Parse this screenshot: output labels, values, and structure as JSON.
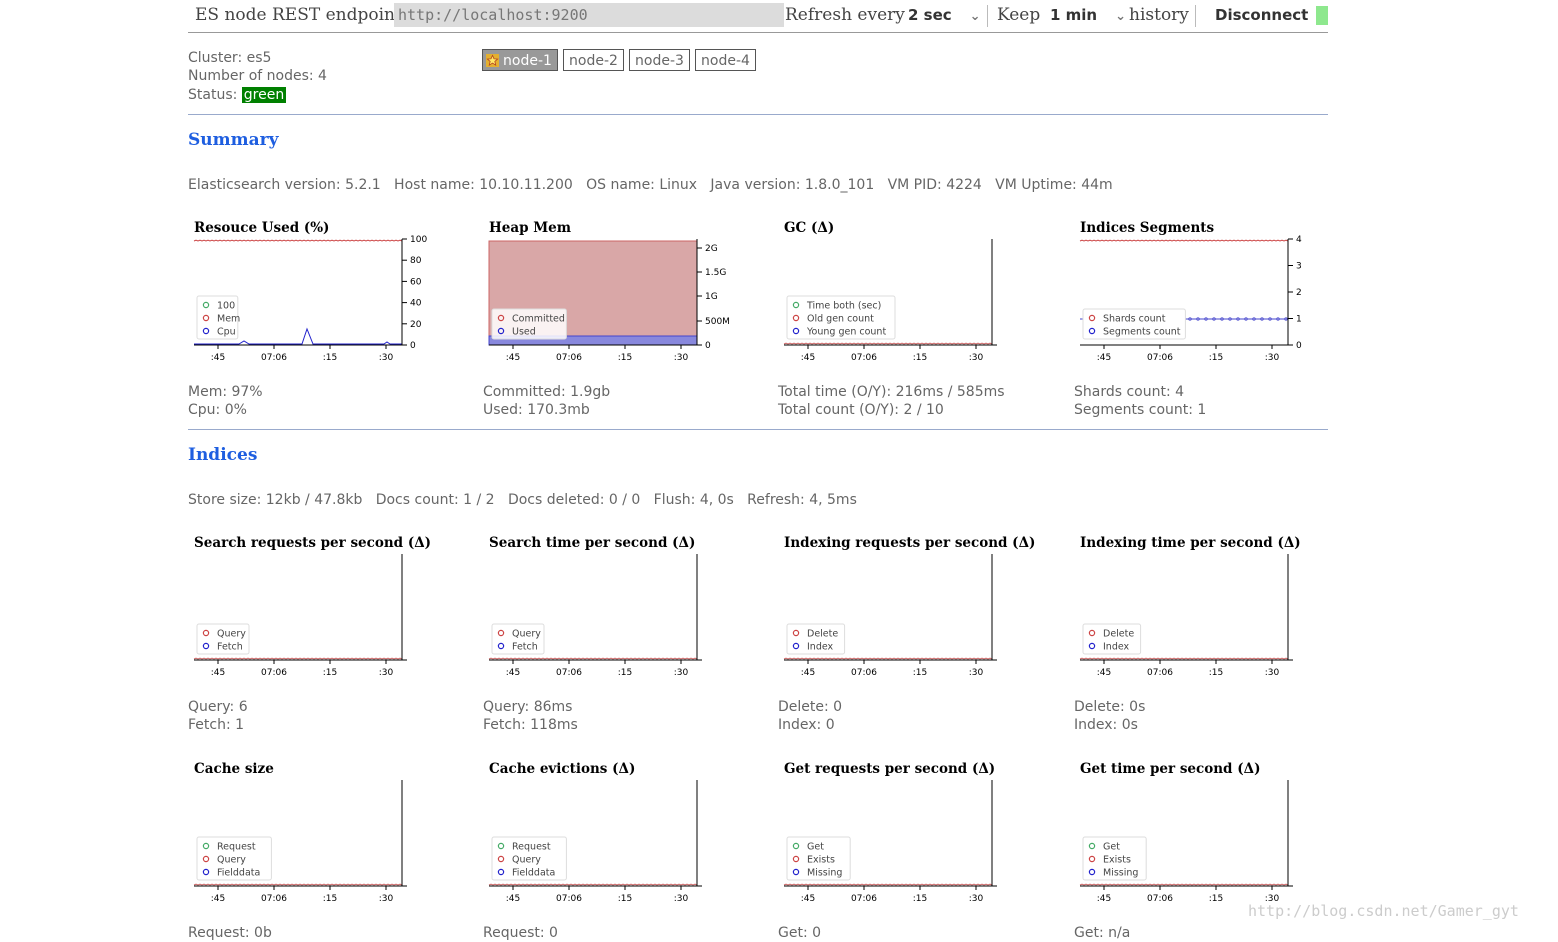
{
  "toolbar": {
    "endpoint_label": "ES node REST endpoint",
    "endpoint_value": "http://localhost:9200",
    "refresh_label": "Refresh every",
    "refresh_value": "2 sec",
    "keep_label": "Keep",
    "keep_value": "1 min",
    "history_label": "history",
    "disconnect_label": "Disconnect",
    "connected_color": "#8ee88e"
  },
  "cluster": {
    "name_label": "Cluster: es5",
    "nodes_label": "Number of nodes: 4",
    "status_prefix": "Status:",
    "status": "green",
    "nodes": [
      "node-1",
      "node-2",
      "node-3",
      "node-4"
    ]
  },
  "summary": {
    "title": "Summary",
    "info": "Elasticsearch version: 5.2.1   Host name: 10.10.11.200   OS name: Linux   Java version: 1.8.0_101   VM PID: 4224   VM Uptime: 44m"
  },
  "indices": {
    "title": "Indices",
    "info": "Store size: 12kb / 47.8kb   Docs count: 1 / 2   Docs deleted: 0 / 0   Flush: 4, 0s   Refresh: 4, 5ms"
  },
  "time_ticks": [
    ":45",
    "07:06",
    ":15",
    ":30"
  ],
  "charts": [
    {
      "title": "Resouce Used (%)",
      "yticks": [
        "100",
        "80",
        "60",
        "40",
        "20",
        "0"
      ],
      "series": [
        {
          "name": "100",
          "color": "#44aa66"
        },
        {
          "name": "Mem",
          "color": "#cc4444"
        },
        {
          "name": "Cpu",
          "color": "#2222cc"
        }
      ],
      "stats": [
        "Mem: 97%",
        "Cpu: 0%"
      ]
    },
    {
      "title": "Heap Mem",
      "yticks": [
        "2G",
        "1.5G",
        "1G",
        "500M",
        "0"
      ],
      "series": [
        {
          "name": "Committed",
          "color": "#cc4444"
        },
        {
          "name": "Used",
          "color": "#2222cc"
        }
      ],
      "stats": [
        "Committed: 1.9gb",
        "Used: 170.3mb"
      ]
    },
    {
      "title": "GC (Δ)",
      "yticks": [],
      "series": [
        {
          "name": "Time both (sec)",
          "color": "#44aa66"
        },
        {
          "name": "Old gen count",
          "color": "#cc4444"
        },
        {
          "name": "Young gen count",
          "color": "#2222cc"
        }
      ],
      "stats": [
        "Total time (O/Y): 216ms / 585ms",
        "Total count (O/Y): 2 / 10"
      ]
    },
    {
      "title": "Indices Segments",
      "yticks": [
        "4",
        "3",
        "2",
        "1",
        "0"
      ],
      "series": [
        {
          "name": "Shards count",
          "color": "#cc4444"
        },
        {
          "name": "Segments count",
          "color": "#2222cc"
        }
      ],
      "stats": [
        "Shards count: 4",
        "Segments count: 1"
      ]
    },
    {
      "title": "Search requests per second (Δ)",
      "yticks": [],
      "series": [
        {
          "name": "Query",
          "color": "#cc4444"
        },
        {
          "name": "Fetch",
          "color": "#2222cc"
        }
      ],
      "stats": [
        "Query: 6",
        "Fetch: 1"
      ]
    },
    {
      "title": "Search time per second (Δ)",
      "yticks": [],
      "series": [
        {
          "name": "Query",
          "color": "#cc4444"
        },
        {
          "name": "Fetch",
          "color": "#2222cc"
        }
      ],
      "stats": [
        "Query: 86ms",
        "Fetch: 118ms"
      ]
    },
    {
      "title": "Indexing requests per second (Δ)",
      "yticks": [],
      "series": [
        {
          "name": "Delete",
          "color": "#cc4444"
        },
        {
          "name": "Index",
          "color": "#2222cc"
        }
      ],
      "stats": [
        "Delete: 0",
        "Index: 0"
      ]
    },
    {
      "title": "Indexing time per second (Δ)",
      "yticks": [],
      "series": [
        {
          "name": "Delete",
          "color": "#cc4444"
        },
        {
          "name": "Index",
          "color": "#2222cc"
        }
      ],
      "stats": [
        "Delete: 0s",
        "Index: 0s"
      ]
    },
    {
      "title": "Cache size",
      "yticks": [],
      "series": [
        {
          "name": "Request",
          "color": "#44aa66"
        },
        {
          "name": "Query",
          "color": "#cc4444"
        },
        {
          "name": "Fielddata",
          "color": "#2222cc"
        }
      ],
      "stats": [
        "Request: 0b"
      ]
    },
    {
      "title": "Cache evictions (Δ)",
      "yticks": [],
      "series": [
        {
          "name": "Request",
          "color": "#44aa66"
        },
        {
          "name": "Query",
          "color": "#cc4444"
        },
        {
          "name": "Fielddata",
          "color": "#2222cc"
        }
      ],
      "stats": [
        "Request: 0"
      ]
    },
    {
      "title": "Get requests per second (Δ)",
      "yticks": [],
      "series": [
        {
          "name": "Get",
          "color": "#44aa66"
        },
        {
          "name": "Exists",
          "color": "#cc4444"
        },
        {
          "name": "Missing",
          "color": "#2222cc"
        }
      ],
      "stats": [
        "Get: 0"
      ]
    },
    {
      "title": "Get time per second (Δ)",
      "yticks": [],
      "series": [
        {
          "name": "Get",
          "color": "#44aa66"
        },
        {
          "name": "Exists",
          "color": "#cc4444"
        },
        {
          "name": "Missing",
          "color": "#2222cc"
        }
      ],
      "stats": [
        "Get: n/a"
      ]
    }
  ],
  "watermark": "http://blog.csdn.net/Gamer_gyt"
}
